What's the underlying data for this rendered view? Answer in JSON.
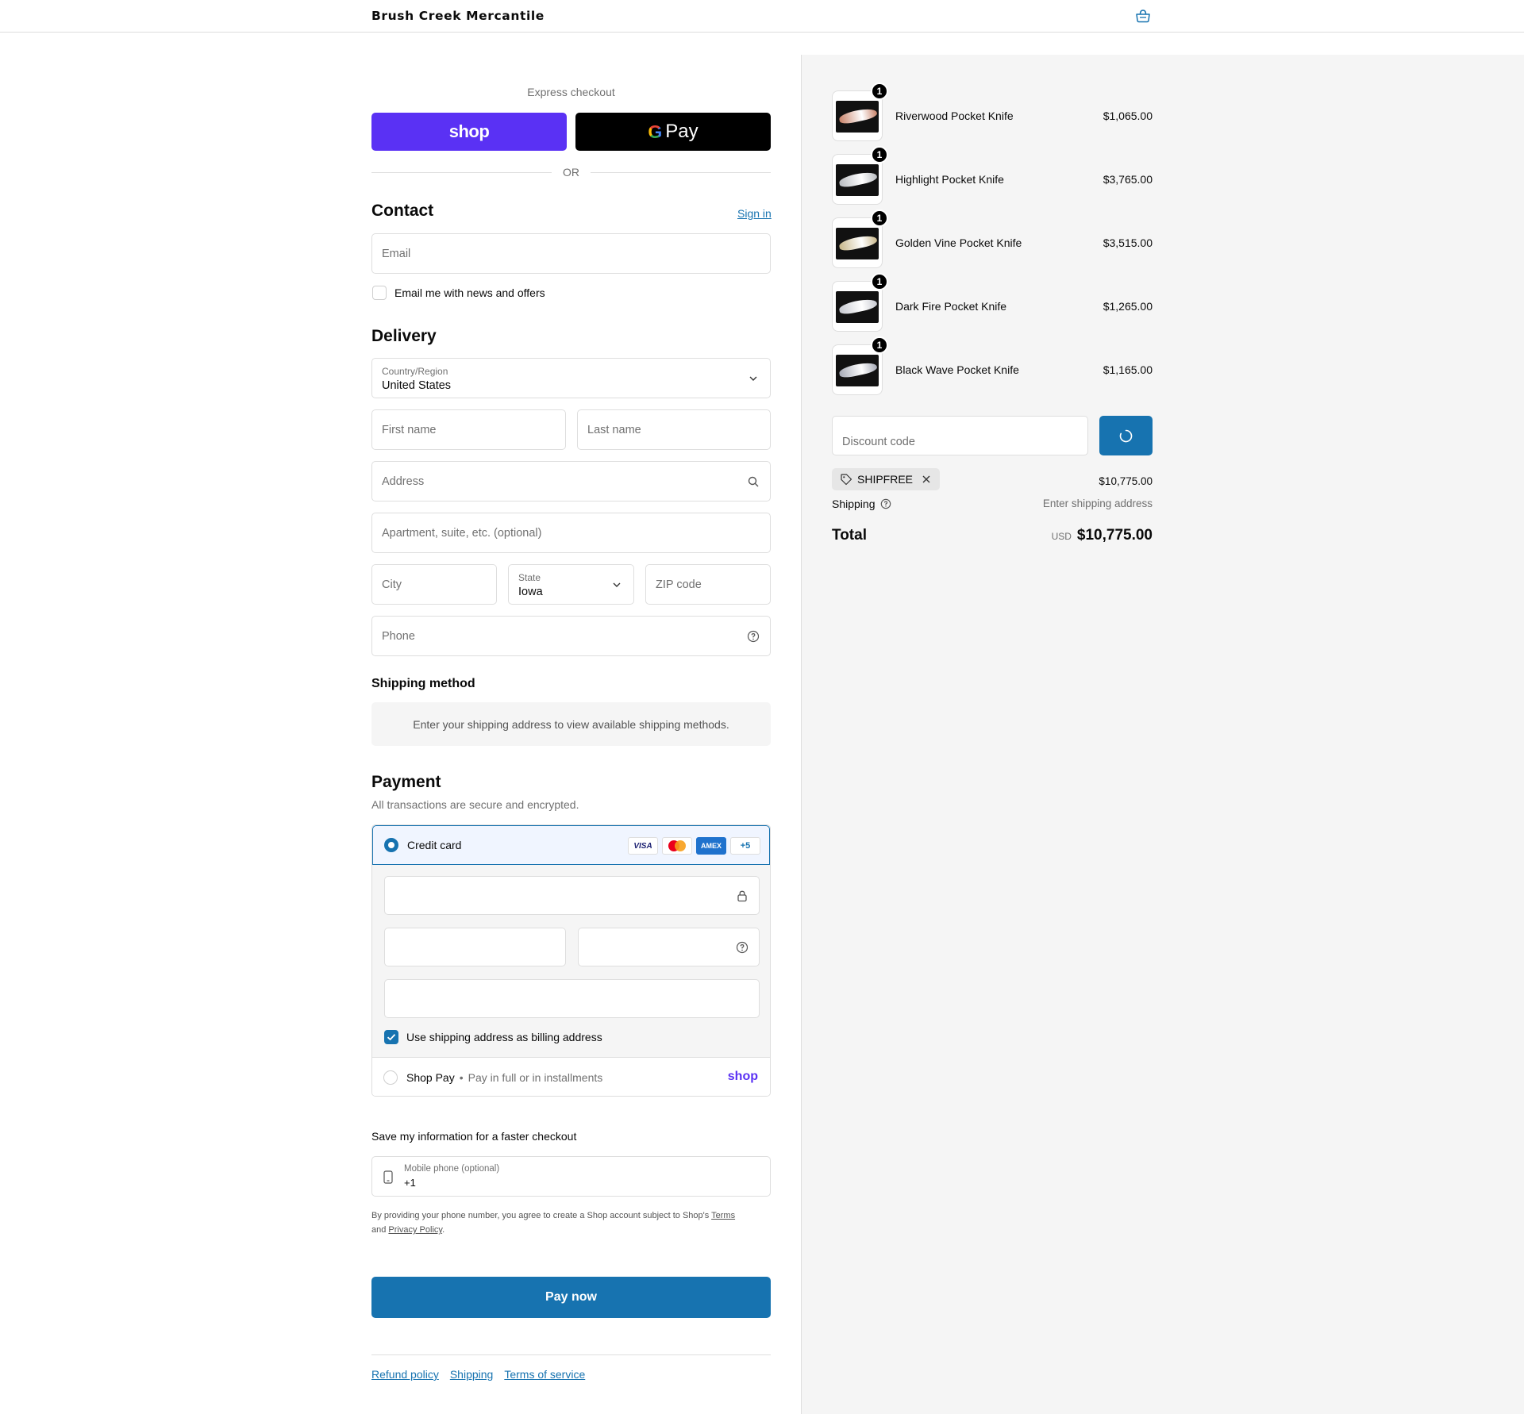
{
  "header": {
    "brand": "Brush Creek Mercantile",
    "cart_icon": "bag-icon"
  },
  "express": {
    "title": "Express checkout",
    "shop_label": "shop",
    "gpay_g": "G",
    "gpay_label": "Pay",
    "or_label": "OR"
  },
  "contact": {
    "title": "Contact",
    "sign_in": "Sign in",
    "email_placeholder": "Email",
    "news_label": "Email me with news and offers"
  },
  "delivery": {
    "title": "Delivery",
    "country_label": "Country/Region",
    "country_value": "United States",
    "first_name": "First name",
    "last_name": "Last name",
    "address": "Address",
    "apartment": "Apartment, suite, etc. (optional)",
    "city": "City",
    "state_label": "State",
    "state_value": "Iowa",
    "zip": "ZIP code",
    "phone": "Phone"
  },
  "shipping_method": {
    "title": "Shipping method",
    "info": "Enter your shipping address to view available shipping methods."
  },
  "payment": {
    "title": "Payment",
    "subtitle": "All transactions are secure and encrypted.",
    "credit_card": "Credit card",
    "cards": [
      "VISA",
      "",
      "AMEX",
      "+5"
    ],
    "billing_label": "Use shipping address as billing address",
    "shop_pay": "Shop Pay",
    "shop_pay_sep": "•",
    "shop_pay_sub": "Pay in full or in installments",
    "shop_pay_logo": "shop"
  },
  "save_info": {
    "title": "Save my information for a faster checkout",
    "mobile_label": "Mobile phone (optional)",
    "mobile_value": "+1",
    "terms_prefix": "By providing your phone number, you agree to create a Shop account subject to Shop's",
    "terms_link": "Terms",
    "and": "and",
    "privacy_link": "Privacy Policy",
    "period": "."
  },
  "pay_now": "Pay now",
  "footer": {
    "links": [
      "Refund policy",
      "Shipping",
      "Terms of service"
    ]
  },
  "summary": {
    "items": [
      {
        "name": "Riverwood Pocket Knife",
        "price": "$1,065.00",
        "qty": "1",
        "blade": "#c9836a"
      },
      {
        "name": "Highlight Pocket Knife",
        "price": "$3,765.00",
        "qty": "1",
        "blade": "#b9bcc0"
      },
      {
        "name": "Golden Vine Pocket Knife",
        "price": "$3,515.00",
        "qty": "1",
        "blade": "#c8b78a"
      },
      {
        "name": "Dark Fire Pocket Knife",
        "price": "$1,265.00",
        "qty": "1",
        "blade": "#c7c9d0"
      },
      {
        "name": "Black Wave Pocket Knife",
        "price": "$1,165.00",
        "qty": "1",
        "blade": "#a6aab6"
      }
    ],
    "discount_placeholder": "Discount code",
    "discount_tag": "SHIPFREE",
    "subtotal": "$10,775.00",
    "shipping_label": "Shipping",
    "shipping_value": "Enter shipping address",
    "total_label": "Total",
    "total_currency": "USD",
    "total_value": "$10,775.00"
  },
  "colors": {
    "accent": "#1773b0",
    "shop_purple": "#5a31f4"
  }
}
